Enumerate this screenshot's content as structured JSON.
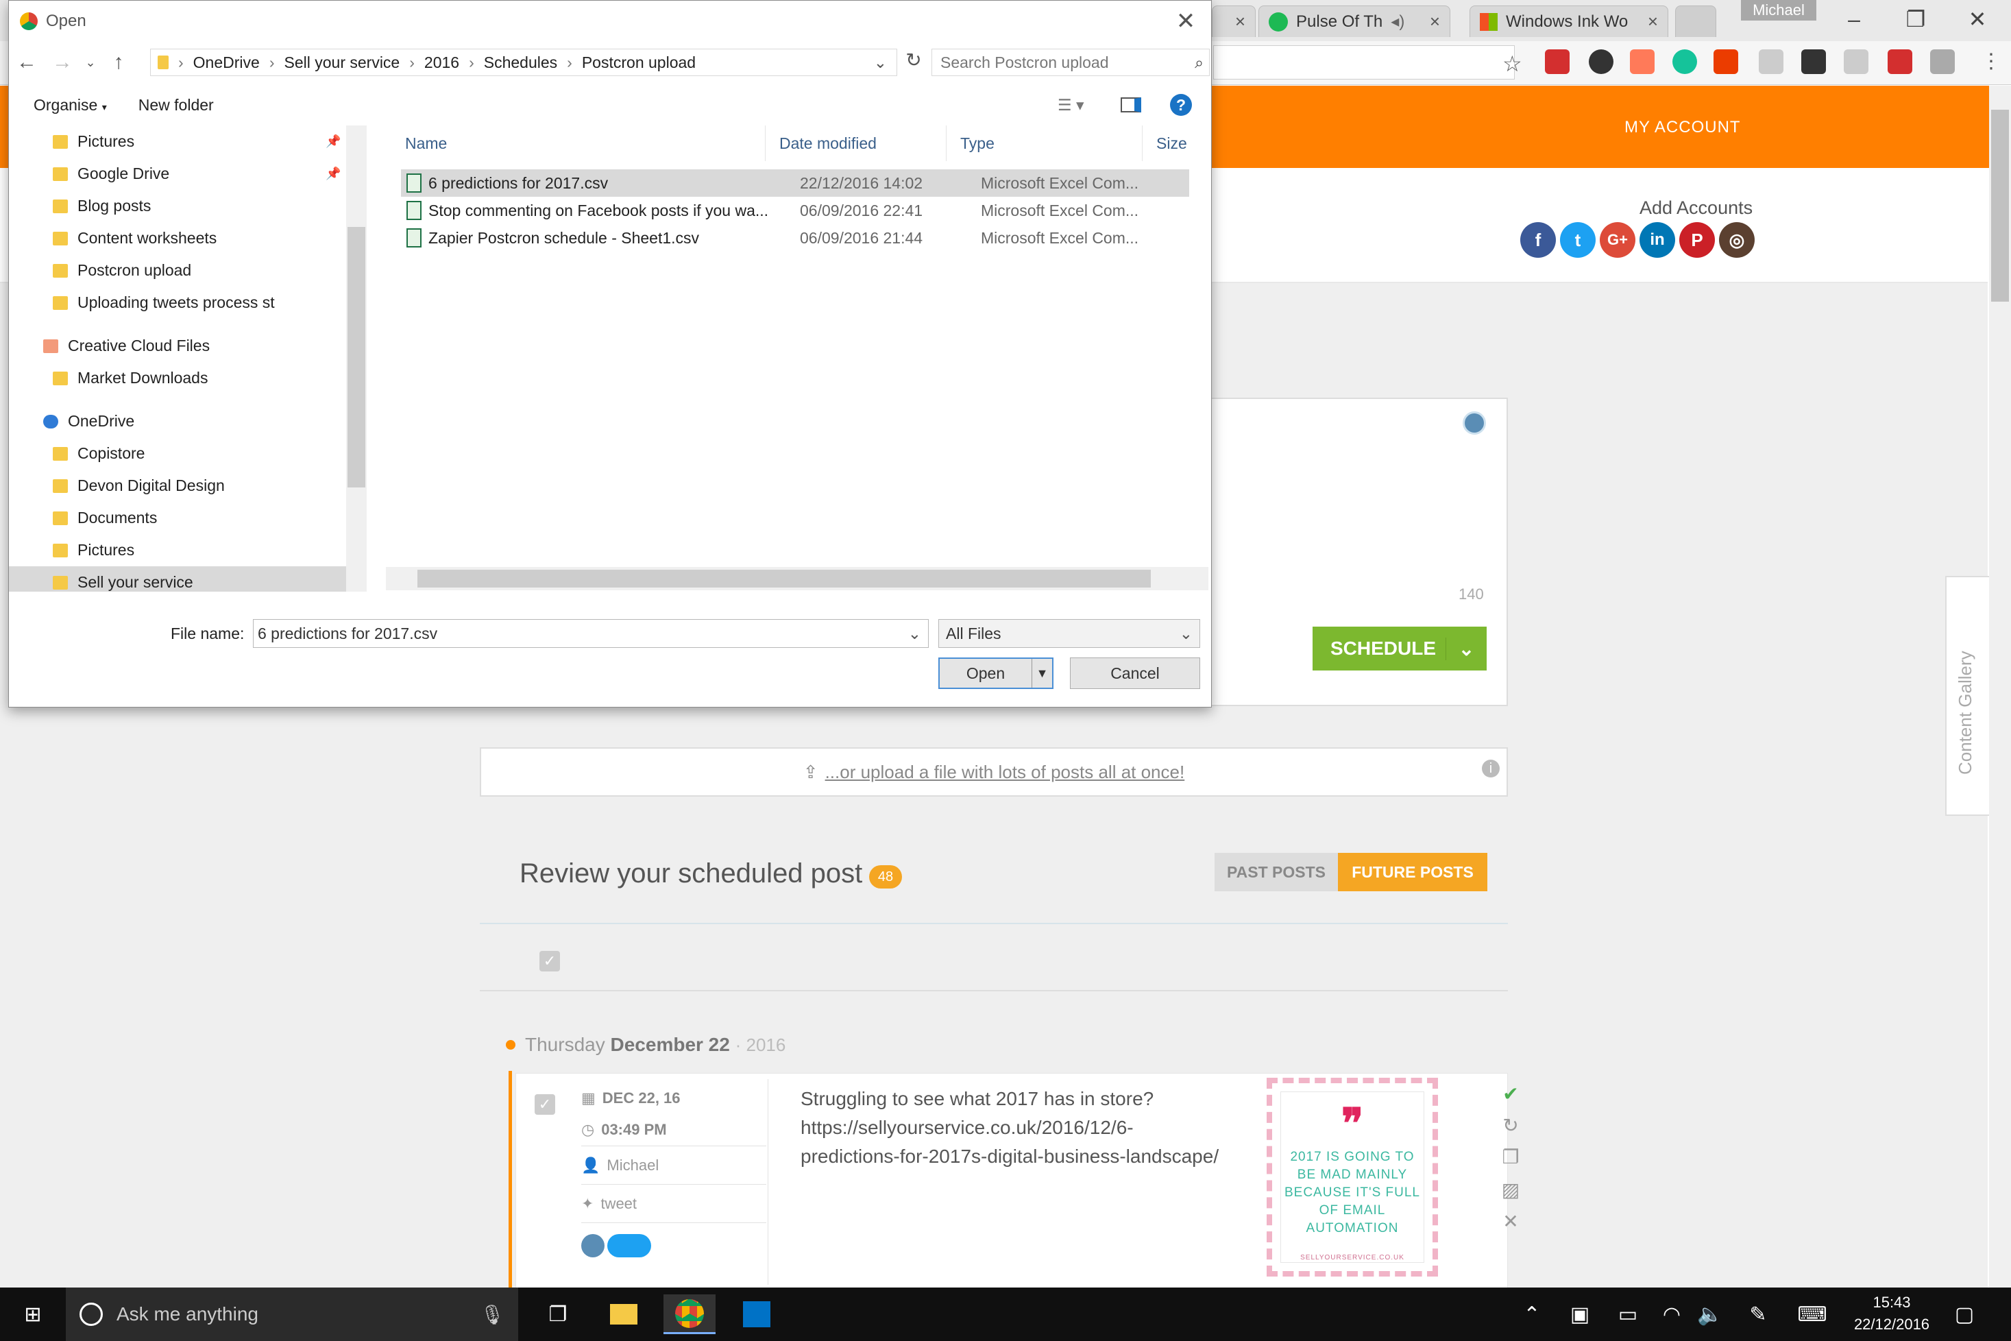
{
  "browser": {
    "tabs": [
      {
        "label": "Pulse Of Th"
      },
      {
        "label": "Windows Ink Wo"
      }
    ],
    "user": "Michael"
  },
  "site": {
    "my_account": "MY ACCOUNT",
    "add_accounts": "Add Accounts",
    "char_count": "140",
    "schedule": "SCHEDULE",
    "upload_text": "...or upload a file with lots of posts all at once!",
    "review_title": "Review your scheduled post",
    "review_count": "48",
    "past_posts": "PAST POSTS",
    "future_posts": "FUTURE POSTS",
    "date_day": "Thursday",
    "date_main": "December 22",
    "date_year": "· 2016",
    "content_gallery": "Content Gallery",
    "post": {
      "date": "DEC 22, 16",
      "time": "03:49 PM",
      "author": "Michael",
      "type": "tweet",
      "text": "Struggling to see what 2017 has in store? https://sellyourservice.co.uk/2016/12/6-predictions-for-2017s-digital-business-landscape/",
      "quote_text": "2017 IS GOING TO BE MAD MAINLY BECAUSE IT'S FULL OF EMAIL AUTOMATION",
      "quote_url": "SELLYOURSERVICE.CO.UK"
    }
  },
  "dialog": {
    "title": "Open",
    "path": [
      "OneDrive",
      "Sell your service",
      "2016",
      "Schedules",
      "Postcron upload"
    ],
    "search_placeholder": "Search Postcron upload",
    "organise": "Organise",
    "new_folder": "New folder",
    "nav_items": [
      {
        "label": "Pictures"
      },
      {
        "label": "Google Drive"
      },
      {
        "label": "Blog posts"
      },
      {
        "label": "Content worksheets"
      },
      {
        "label": "Postcron upload"
      },
      {
        "label": "Uploading tweets process st"
      },
      {
        "label": "Creative Cloud Files"
      },
      {
        "label": "Market Downloads"
      },
      {
        "label": "OneDrive"
      },
      {
        "label": "Copistore"
      },
      {
        "label": "Devon Digital Design"
      },
      {
        "label": "Documents"
      },
      {
        "label": "Pictures"
      },
      {
        "label": "Sell your service"
      }
    ],
    "columns": {
      "name": "Name",
      "date": "Date modified",
      "type": "Type",
      "size": "Size"
    },
    "files": [
      {
        "name": "6 predictions for 2017.csv",
        "date": "22/12/2016 14:02",
        "type": "Microsoft Excel Com..."
      },
      {
        "name": "Stop commenting on Facebook posts if you wa...",
        "date": "06/09/2016 22:41",
        "type": "Microsoft Excel Com..."
      },
      {
        "name": "Zapier Postcron schedule - Sheet1.csv",
        "date": "06/09/2016 21:44",
        "type": "Microsoft Excel Com..."
      }
    ],
    "file_name_label": "File name:",
    "file_name_value": "6 predictions for 2017.csv",
    "file_type": "All Files",
    "open": "Open",
    "cancel": "Cancel"
  },
  "taskbar": {
    "search": "Ask me anything",
    "time": "15:43",
    "date": "22/12/2016"
  }
}
